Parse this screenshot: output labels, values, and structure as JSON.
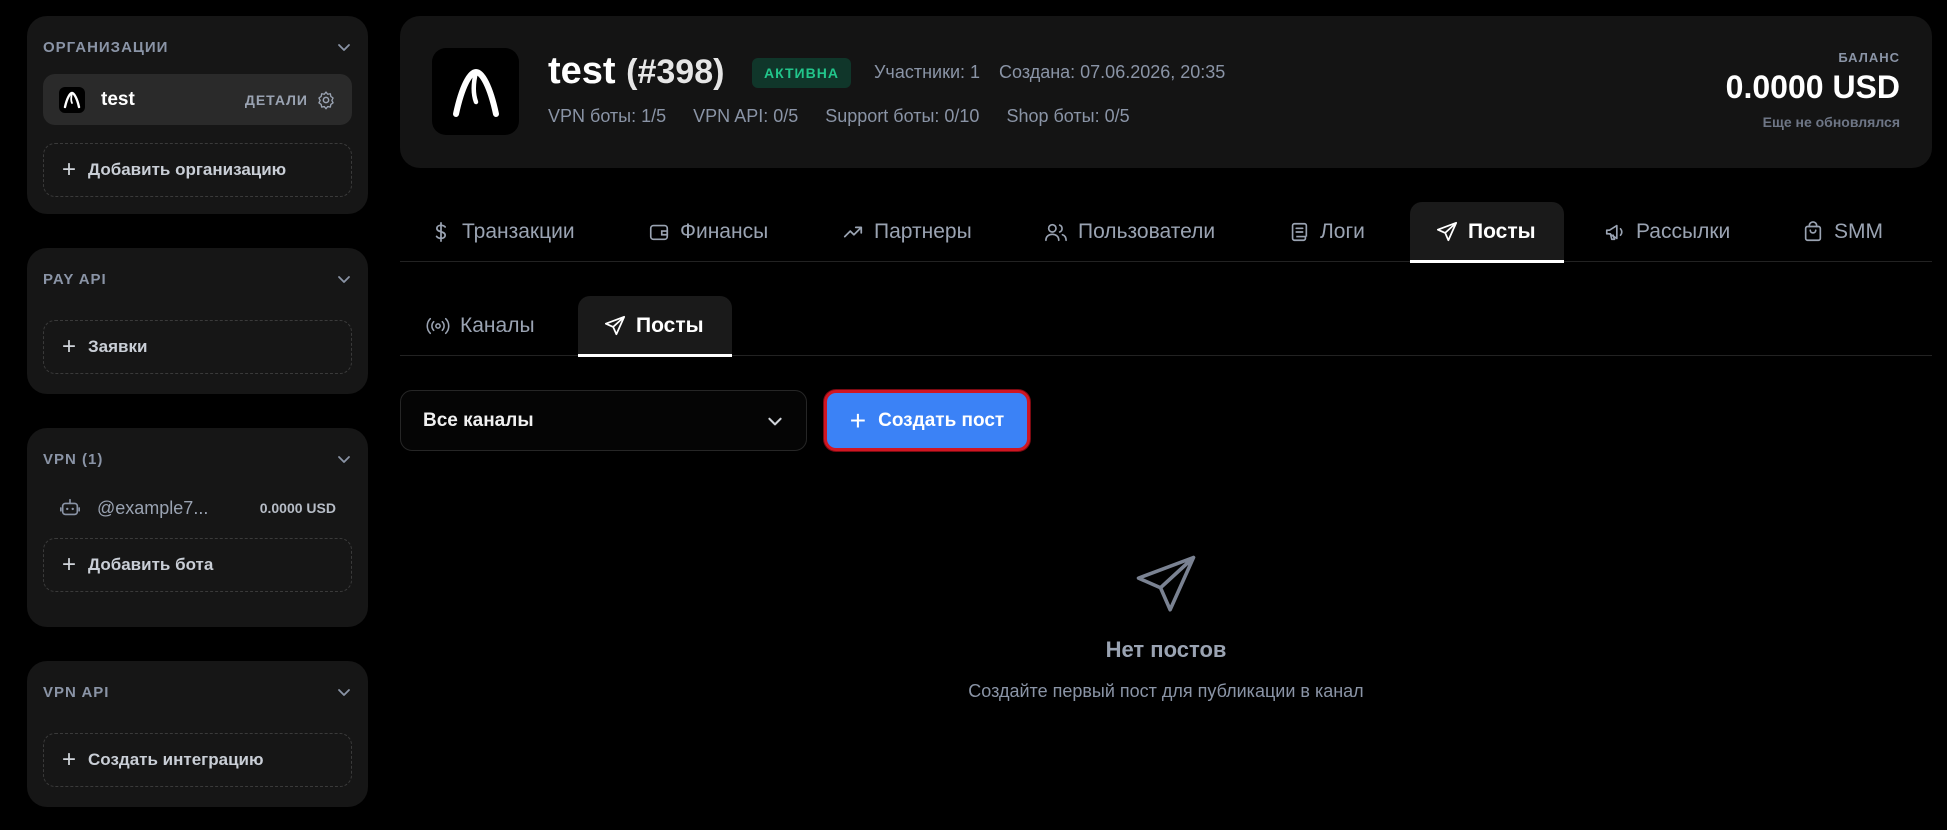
{
  "sidebar": {
    "organizations": {
      "title": "ОРГАНИЗАЦИИ",
      "org_name": "test",
      "details_label": "ДЕТАЛИ",
      "add_label": "Добавить организацию"
    },
    "pay_api": {
      "title": "PAY API",
      "requests_label": "Заявки"
    },
    "vpn": {
      "title": "VPN (1)",
      "bot_name": "@example7...",
      "bot_balance": "0.0000 USD",
      "add_bot_label": "Добавить бота"
    },
    "vpn_api": {
      "title": "VPN API",
      "create_label": "Создать интеграцию"
    }
  },
  "header": {
    "org_name": "test",
    "org_id": "(#398)",
    "status": "АКТИВНА",
    "participants": "Участники: 1",
    "created": "Создана: 07.06.2026, 20:35",
    "vpn_bots": "VPN боты: 1/5",
    "vpn_api": "VPN API: 0/5",
    "support_bots": "Support боты: 0/10",
    "shop_bots": "Shop боты: 0/5",
    "balance_label": "БАЛАНС",
    "balance_value": "0.0000 USD",
    "balance_note": "Еще не обновлялся"
  },
  "tabs": [
    {
      "label": "Транзакции",
      "icon": "dollar-icon"
    },
    {
      "label": "Финансы",
      "icon": "wallet-icon"
    },
    {
      "label": "Партнеры",
      "icon": "trending-up-icon"
    },
    {
      "label": "Пользователи",
      "icon": "users-icon"
    },
    {
      "label": "Логи",
      "icon": "scroll-icon"
    },
    {
      "label": "Посты",
      "icon": "send-icon",
      "active": true
    },
    {
      "label": "Рассылки",
      "icon": "megaphone-icon"
    },
    {
      "label": "SMM",
      "icon": "shopping-bag-icon"
    }
  ],
  "subtabs": [
    {
      "label": "Каналы",
      "icon": "broadcast-icon"
    },
    {
      "label": "Посты",
      "icon": "send-icon",
      "active": true
    }
  ],
  "filter": {
    "channel_select": "Все каналы",
    "create_button": "Создать пост"
  },
  "empty_state": {
    "title": "Нет постов",
    "subtitle": "Создайте первый пост для публикации в канал"
  },
  "colors": {
    "accent_blue": "#3b82f6",
    "status_green": "#22c58b",
    "highlight_red": "#d01622"
  }
}
